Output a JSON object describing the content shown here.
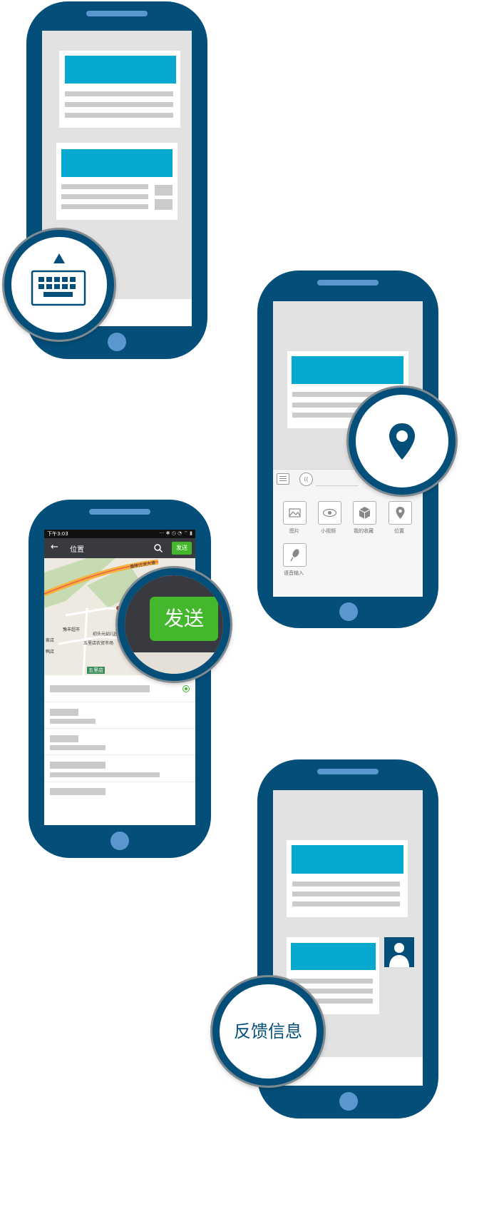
{
  "phone3": {
    "status_time": "下午3:03",
    "title": "位置",
    "send_label": "发送",
    "map_labels": {
      "poi1": "豫丰超市",
      "poi2": "初头元幼儿园",
      "poi3": "五里店农贸市场",
      "poi4": "鸭店",
      "station": "五里店",
      "poi5": "家店",
      "road": "嘉陵江滨大道"
    }
  },
  "phone2": {
    "panel_items": [
      {
        "icon": "image-icon",
        "label": "图片"
      },
      {
        "icon": "eye-icon",
        "label": "小视频"
      },
      {
        "icon": "cube-icon",
        "label": "我的收藏"
      },
      {
        "icon": "location-icon",
        "label": "位置"
      },
      {
        "icon": "mic-icon",
        "label": "语音输入"
      }
    ]
  },
  "zoom_send_label": "发送",
  "feedback_label": "反馈信息",
  "colors": {
    "phone_body": "#044f7a",
    "accent_blue": "#05a8cf",
    "send_green": "#44b82c",
    "screen_gray": "#e2e2e2",
    "placeholder_gray": "#cbcbcb"
  }
}
